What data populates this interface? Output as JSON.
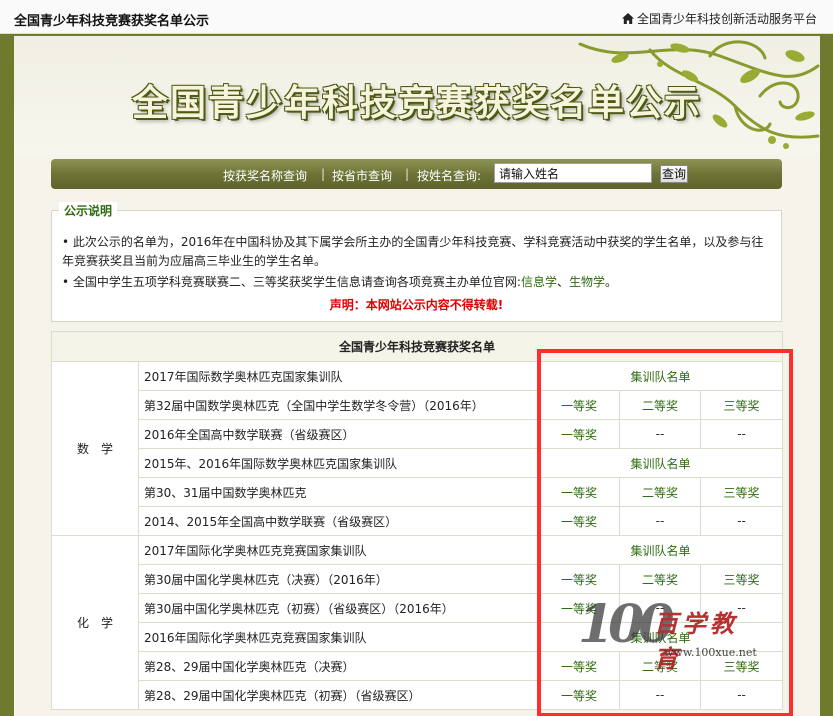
{
  "topbar": {
    "site_title": "全国青少年科技竞赛获奖名单公示",
    "platform_label": "全国青少年科技创新活动服务平台"
  },
  "banner": {
    "title": "全国青少年科技竞赛获奖名单公示"
  },
  "search": {
    "by_award": "按获奖名称查询",
    "by_region": "按省市查询",
    "by_name_label": "按姓名查询:",
    "separator": "|",
    "input_value": "请输入姓名",
    "button": "查询"
  },
  "notice": {
    "legend": "公示说明",
    "p1": "• 此次公示的名单为，2016年在中国科协及其下属学会所主办的全国青少年科技竞赛、学科竞赛活动中获奖的学生名单，以及参与往年竞赛获奖且当前为应届高三毕业生的学生名单。",
    "p2_prefix": "• 全国中学生五项学科竞赛联赛二、三等奖获奖学生信息请查询各项竞赛主办单位官网:",
    "link1": "信息学",
    "sep": "、",
    "link2": "生物学",
    "p2_suffix": "。",
    "warning": "声明：本网站公示内容不得转载!"
  },
  "table": {
    "header": "全国青少年科技竞赛获奖名单",
    "subjects": [
      {
        "name": "数学",
        "rows": [
          {
            "competition": "2017年国际数学奥林匹克国家集训队",
            "cells": [
              "集训队名单"
            ]
          },
          {
            "competition": "第32届中国数学奥林匹克（全国中学生数学冬令营）（2016年）",
            "cells": [
              "一等奖",
              "二等奖",
              "三等奖"
            ]
          },
          {
            "competition": "2016年全国高中数学联赛（省级赛区）",
            "cells": [
              "一等奖",
              "--",
              "--"
            ]
          },
          {
            "competition": "2015年、2016年国际数学奥林匹克国家集训队",
            "cells": [
              "集训队名单"
            ]
          },
          {
            "competition": "第30、31届中国数学奥林匹克",
            "cells": [
              "一等奖",
              "二等奖",
              "三等奖"
            ]
          },
          {
            "competition": "2014、2015年全国高中数学联赛（省级赛区）",
            "cells": [
              "一等奖",
              "--",
              "--"
            ]
          }
        ]
      },
      {
        "name": "化学",
        "rows": [
          {
            "competition": "2017年国际化学奥林匹克竞赛国家集训队",
            "cells": [
              "集训队名单"
            ]
          },
          {
            "competition": "第30届中国化学奥林匹克（决赛）（2016年）",
            "cells": [
              "一等奖",
              "二等奖",
              "三等奖"
            ]
          },
          {
            "competition": "第30届中国化学奥林匹克（初赛）（省级赛区）（2016年）",
            "cells": [
              "一等奖",
              "--",
              "--"
            ]
          },
          {
            "competition": "2016年国际化学奥林匹克竞赛国家集训队",
            "cells": [
              "集训队名单"
            ]
          },
          {
            "competition": "第28、29届中国化学奥林匹克（决赛）",
            "cells": [
              "一等奖",
              "二等奖",
              "三等奖"
            ]
          },
          {
            "competition": "第28、29届中国化学奥林匹克（初赛）（省级赛区）",
            "cells": [
              "一等奖",
              "--",
              "--"
            ]
          }
        ]
      }
    ]
  },
  "watermark": {
    "number": "100",
    "brand": "百学教育",
    "url": "www.100xue.net"
  },
  "colors": {
    "accent_green": "#2e6b12",
    "bar_olive": "#6e7336",
    "warning_red": "#e00000",
    "highlight_red": "#ff2d2d"
  },
  "icons": {
    "home": "home-icon",
    "vine": "vine-decoration"
  }
}
